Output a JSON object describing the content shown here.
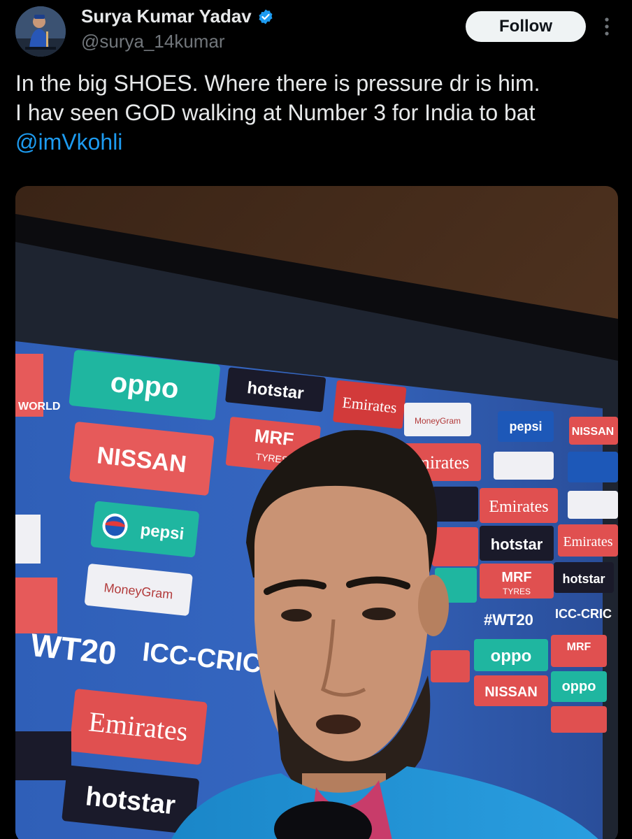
{
  "author": {
    "display_name": "Surya Kumar Yadav",
    "handle": "@surya_14kumar",
    "verified": true,
    "avatar_icon": "profile-photo"
  },
  "actions": {
    "follow_label": "Follow",
    "more_icon": "vertical-ellipsis-icon"
  },
  "tweet": {
    "line1": "In the big SHOES. Where there is pressure dr is him.",
    "line2": "I hav seen GOD walking at Number 3 for India to bat",
    "mention": "@imVkohli"
  },
  "media": {
    "type": "photo",
    "description_icon": "tv-screen-photo",
    "board_texts": {
      "oppo": "oppo",
      "nissan": "NISSAN",
      "pepsi": "pepsi",
      "emirates": "Emirates",
      "hotstar": "hotstar",
      "mrf": "MRF",
      "mrf_sub": "TYRES",
      "hashtag": "#WT20",
      "icc": "ICC-CRICKET",
      "icc_short": "ICC-CRIC",
      "moneygram": "MoneyGram",
      "world": "WORLD",
      "wt20": "WT20"
    }
  },
  "colors": {
    "background": "#000000",
    "text": "#e7e9ea",
    "secondary": "#71767b",
    "link": "#1d9bf0",
    "verified": "#1d9bf0"
  }
}
